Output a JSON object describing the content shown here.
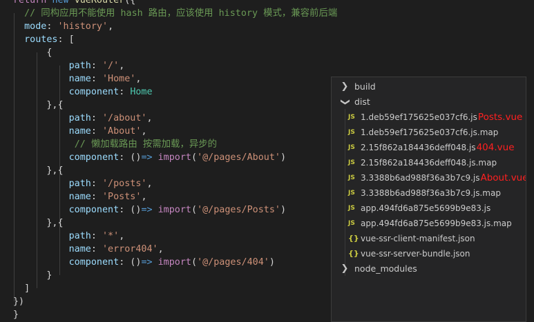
{
  "editor": {
    "lines": [
      [
        [
          "kc",
          "return"
        ],
        [
          "pl",
          " "
        ],
        [
          "kw",
          "new"
        ],
        [
          "pl",
          " "
        ],
        [
          "fn",
          "vueRouter"
        ],
        [
          "pl",
          "({"
        ]
      ],
      [
        [
          "pl",
          "  "
        ],
        [
          "cmt",
          "// 同构应用不能使用 hash 路由，应该使用 history 模式，兼容前后端"
        ]
      ],
      [
        [
          "pl",
          "  "
        ],
        [
          "prop",
          "mode"
        ],
        [
          "pl",
          ": "
        ],
        [
          "str",
          "'history'"
        ],
        [
          "pl",
          ","
        ]
      ],
      [
        [
          "pl",
          "  "
        ],
        [
          "prop",
          "routes"
        ],
        [
          "pl",
          ": ["
        ]
      ],
      [
        [
          "pl",
          "      {"
        ]
      ],
      [
        [
          "pl",
          "          "
        ],
        [
          "prop",
          "path"
        ],
        [
          "pl",
          ": "
        ],
        [
          "str",
          "'/'"
        ],
        [
          "pl",
          ","
        ]
      ],
      [
        [
          "pl",
          "          "
        ],
        [
          "prop",
          "name"
        ],
        [
          "pl",
          ": "
        ],
        [
          "str",
          "'Home'"
        ],
        [
          "pl",
          ","
        ]
      ],
      [
        [
          "pl",
          "          "
        ],
        [
          "prop",
          "component"
        ],
        [
          "pl",
          ": "
        ],
        [
          "cls",
          "Home"
        ]
      ],
      [
        [
          "pl",
          "      },{"
        ]
      ],
      [
        [
          "pl",
          "          "
        ],
        [
          "prop",
          "path"
        ],
        [
          "pl",
          ": "
        ],
        [
          "str",
          "'/about'"
        ],
        [
          "pl",
          ","
        ]
      ],
      [
        [
          "pl",
          "          "
        ],
        [
          "prop",
          "name"
        ],
        [
          "pl",
          ": "
        ],
        [
          "str",
          "'About'"
        ],
        [
          "pl",
          ","
        ]
      ],
      [
        [
          "pl",
          "           "
        ],
        [
          "cmt",
          "// 懒加载路由 按需加载，异步的"
        ]
      ],
      [
        [
          "pl",
          "          "
        ],
        [
          "prop",
          "component"
        ],
        [
          "pl",
          ": ()"
        ],
        [
          "kw",
          "=>"
        ],
        [
          "pl",
          " "
        ],
        [
          "kc",
          "import"
        ],
        [
          "pl",
          "("
        ],
        [
          "str",
          "'@/pages/About'"
        ],
        [
          "pl",
          ")"
        ]
      ],
      [
        [
          "pl",
          "      },{"
        ]
      ],
      [
        [
          "pl",
          "          "
        ],
        [
          "prop",
          "path"
        ],
        [
          "pl",
          ": "
        ],
        [
          "str",
          "'/posts'"
        ],
        [
          "pl",
          ","
        ]
      ],
      [
        [
          "pl",
          "          "
        ],
        [
          "prop",
          "name"
        ],
        [
          "pl",
          ": "
        ],
        [
          "str",
          "'Posts'"
        ],
        [
          "pl",
          ","
        ]
      ],
      [
        [
          "pl",
          "          "
        ],
        [
          "prop",
          "component"
        ],
        [
          "pl",
          ": ()"
        ],
        [
          "kw",
          "=>"
        ],
        [
          "pl",
          " "
        ],
        [
          "kc",
          "import"
        ],
        [
          "pl",
          "("
        ],
        [
          "str",
          "'@/pages/Posts'"
        ],
        [
          "pl",
          ")"
        ]
      ],
      [
        [
          "pl",
          "      },{"
        ]
      ],
      [
        [
          "pl",
          "          "
        ],
        [
          "prop",
          "path"
        ],
        [
          "pl",
          ": "
        ],
        [
          "str",
          "'*'"
        ],
        [
          "pl",
          ","
        ]
      ],
      [
        [
          "pl",
          "          "
        ],
        [
          "prop",
          "name"
        ],
        [
          "pl",
          ": "
        ],
        [
          "str",
          "'error404'"
        ],
        [
          "pl",
          ","
        ]
      ],
      [
        [
          "pl",
          "          "
        ],
        [
          "prop",
          "component"
        ],
        [
          "pl",
          ": ()"
        ],
        [
          "kw",
          "=>"
        ],
        [
          "pl",
          " "
        ],
        [
          "kc",
          "import"
        ],
        [
          "pl",
          "("
        ],
        [
          "str",
          "'@/pages/404'"
        ],
        [
          "pl",
          ")"
        ]
      ],
      [
        [
          "pl",
          "      }"
        ]
      ],
      [
        [
          "pl",
          "  ]"
        ]
      ],
      [
        [
          "pl",
          "})"
        ]
      ],
      [
        [
          "pl",
          "}"
        ]
      ]
    ]
  },
  "explorer": {
    "build": {
      "label": "build",
      "icon": "chevron-right-icon"
    },
    "dist": {
      "label": "dist",
      "icon": "chevron-down-icon"
    },
    "files": [
      {
        "name": "1.deb59ef175625e037cf6.js",
        "type": "JS",
        "annotation": "Posts.vue"
      },
      {
        "name": "1.deb59ef175625e037cf6.js.map",
        "type": "JS",
        "annotation": ""
      },
      {
        "name": "2.15f862a184436deff048.js",
        "type": "JS",
        "annotation": "404.vue"
      },
      {
        "name": "2.15f862a184436deff048.js.map",
        "type": "JS",
        "annotation": ""
      },
      {
        "name": "3.3388b6ad988f36a3b7c9.js",
        "type": "JS",
        "annotation": "About.vue"
      },
      {
        "name": "3.3388b6ad988f36a3b7c9.js.map",
        "type": "JS",
        "annotation": ""
      },
      {
        "name": "app.494fd6a875e5699b9e83.js",
        "type": "JS",
        "annotation": ""
      },
      {
        "name": "app.494fd6a875e5699b9e83.js.map",
        "type": "JS",
        "annotation": ""
      },
      {
        "name": "vue-ssr-client-manifest.json",
        "type": "{}",
        "annotation": ""
      },
      {
        "name": "vue-ssr-server-bundle.json",
        "type": "{}",
        "annotation": ""
      }
    ],
    "node_modules": {
      "label": "node_modules",
      "icon": "chevron-right-icon"
    }
  },
  "colors": {
    "background": "#1e1e1e",
    "panel": "#252526",
    "annotation": "#ff2020",
    "js_icon": "#cbcb41"
  }
}
